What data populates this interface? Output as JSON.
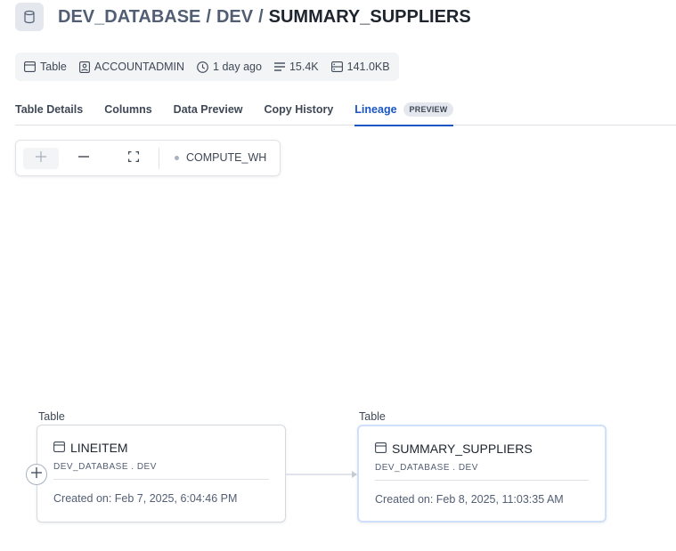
{
  "header": {
    "database": "DEV_DATABASE",
    "schema": "DEV",
    "table": "SUMMARY_SUPPLIERS",
    "separator": "/"
  },
  "meta": {
    "type": "Table",
    "owner": "ACCOUNTADMIN",
    "age": "1 day ago",
    "rows": "15.4K",
    "size": "141.0KB"
  },
  "tabs": [
    {
      "label": "Table Details"
    },
    {
      "label": "Columns"
    },
    {
      "label": "Data Preview"
    },
    {
      "label": "Copy History"
    },
    {
      "label": "Lineage",
      "badge": "PREVIEW",
      "active": true
    }
  ],
  "toolbar": {
    "warehouse": "COMPUTE_WH"
  },
  "lineage": {
    "nodes": [
      {
        "type_label": "Table",
        "name": "LINEITEM",
        "path": "DEV_DATABASE . DEV",
        "created": "Created on: Feb 7, 2025, 6:04:46 PM"
      },
      {
        "type_label": "Table",
        "name": "SUMMARY_SUPPLIERS",
        "path": "DEV_DATABASE . DEV",
        "created": "Created on: Feb 8, 2025, 11:03:35 AM",
        "selected": true
      }
    ]
  },
  "colors": {
    "accent": "#1a56c4",
    "text": "#1e252f",
    "muted": "#525e73",
    "border": "#dfe3e8",
    "selected_border": "#cfe0fb"
  }
}
